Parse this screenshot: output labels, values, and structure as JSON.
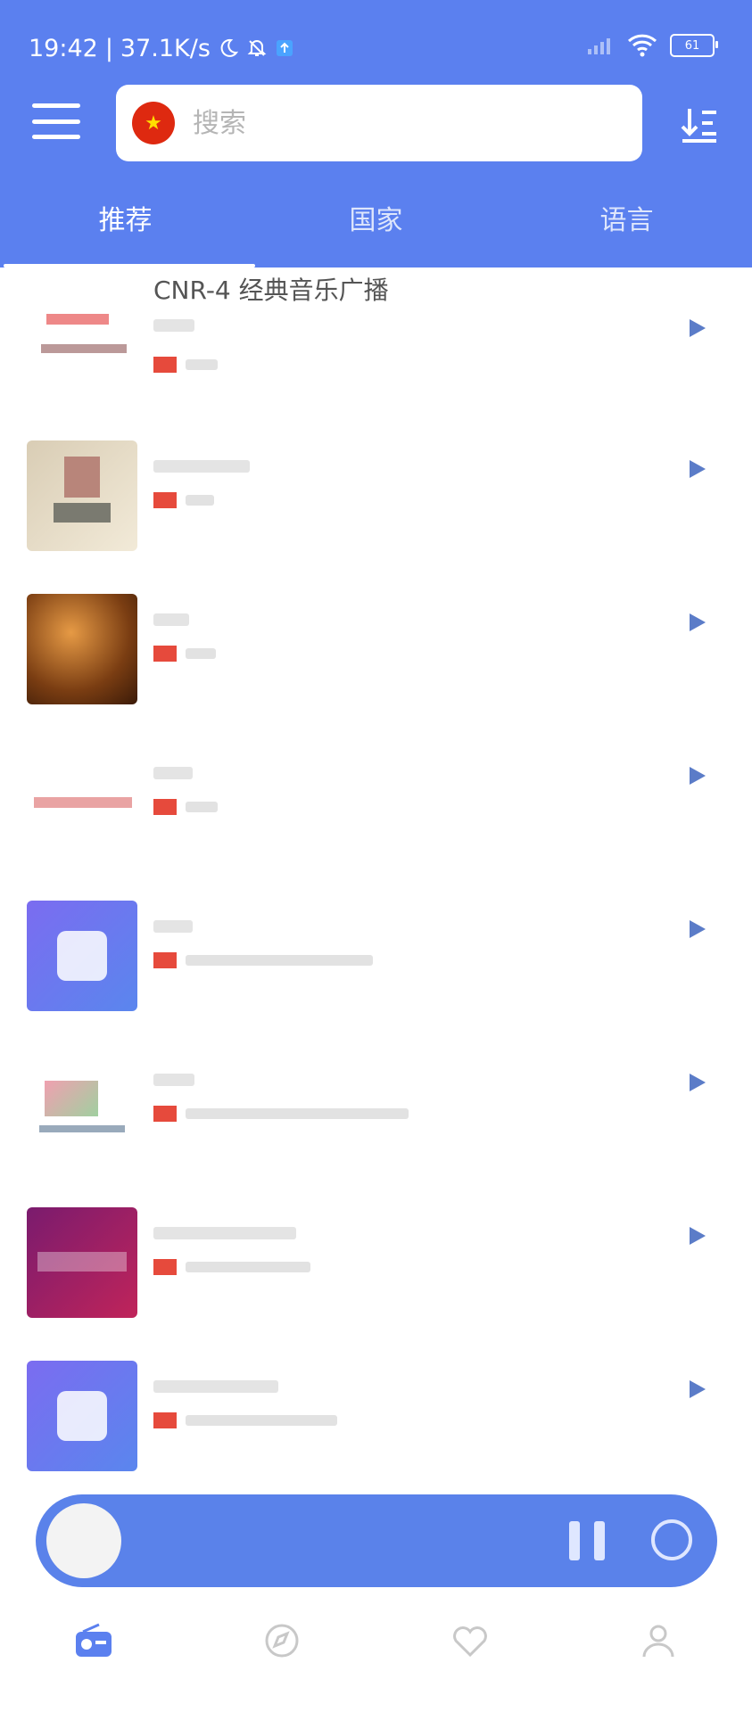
{
  "status_bar": {
    "time": "19:42",
    "speed": "37.1K/s",
    "battery": "61",
    "icons": [
      "moon-icon",
      "bell-off-icon",
      "upload-icon",
      "signal-icon",
      "wifi-icon",
      "battery-icon"
    ]
  },
  "header": {
    "menu_icon": "menu-icon",
    "sort_icon": "sort-icon",
    "search": {
      "placeholder": "搜索",
      "country_flag": "china-flag-icon"
    },
    "tabs": [
      {
        "label": "推荐",
        "active": true
      },
      {
        "label": "国家",
        "active": false
      },
      {
        "label": "语言",
        "active": false
      }
    ]
  },
  "stations": [
    {
      "title": "CNR-4 经典音乐广播",
      "thumb": "white"
    },
    {
      "title": "",
      "thumb": "photo1"
    },
    {
      "title": "",
      "thumb": "photo2"
    },
    {
      "title": "",
      "thumb": "white"
    },
    {
      "title": "",
      "thumb": "blue"
    },
    {
      "title": "",
      "thumb": "white"
    },
    {
      "title": "",
      "thumb": "magenta"
    },
    {
      "title": "",
      "thumb": "blue"
    }
  ],
  "player": {
    "title": "",
    "controls": [
      "pause-icon",
      "timer-icon"
    ]
  },
  "bottom_nav": [
    {
      "label": "",
      "icon": "radio-icon",
      "active": true
    },
    {
      "label": "",
      "icon": "compass-icon",
      "active": false
    },
    {
      "label": "",
      "icon": "heart-icon",
      "active": false
    },
    {
      "label": "",
      "icon": "user-icon",
      "active": false
    }
  ],
  "colors": {
    "primary": "#5b80ef",
    "play_icon": "#5b7cc8",
    "red_badge": "#e64a3c"
  }
}
